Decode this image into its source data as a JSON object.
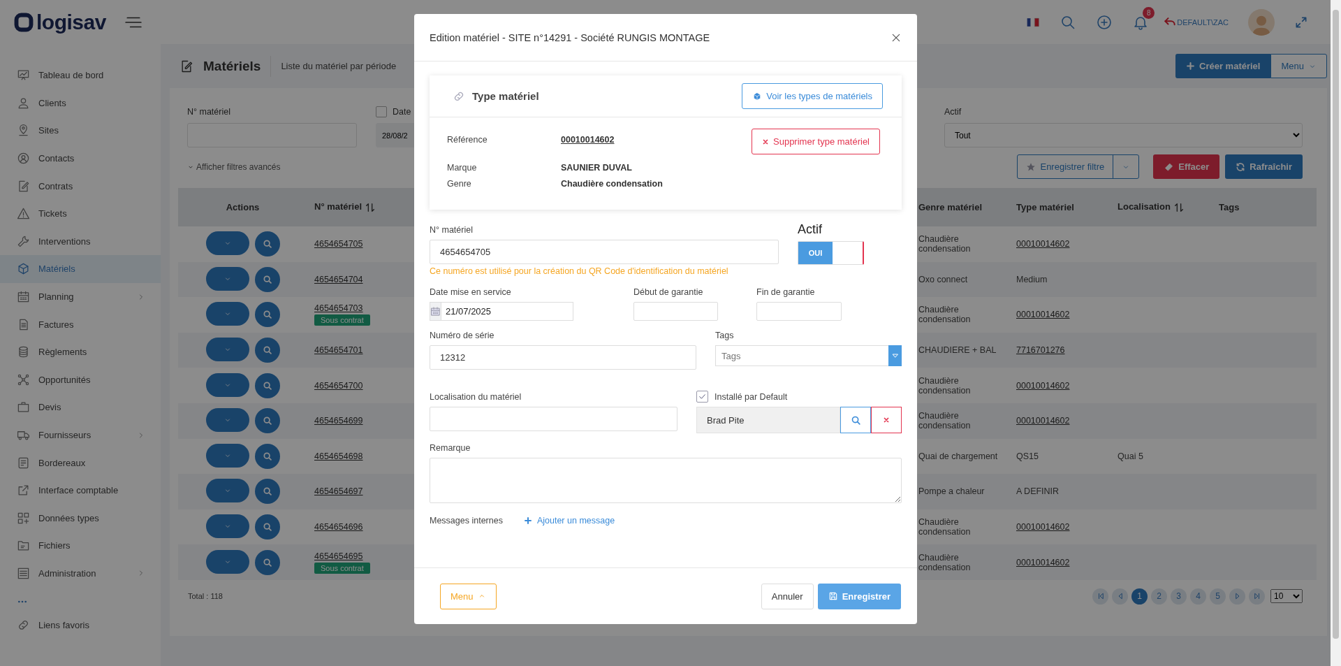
{
  "header": {
    "logo": "logisav",
    "notifications": "8",
    "user": "DEFAULT\\ZAC"
  },
  "sidebar": {
    "items": [
      {
        "label": "Tableau de bord",
        "selected": false,
        "submenu": false
      },
      {
        "label": "Clients",
        "selected": false,
        "submenu": false
      },
      {
        "label": "Sites",
        "selected": false,
        "submenu": false
      },
      {
        "label": "Contacts",
        "selected": false,
        "submenu": false
      },
      {
        "label": "Contrats",
        "selected": false,
        "submenu": false
      },
      {
        "label": "Tickets",
        "selected": false,
        "submenu": false
      },
      {
        "label": "Interventions",
        "selected": false,
        "submenu": false
      },
      {
        "label": "Matériels",
        "selected": true,
        "submenu": false
      },
      {
        "label": "Planning",
        "selected": false,
        "submenu": true
      },
      {
        "label": "Factures",
        "selected": false,
        "submenu": false
      },
      {
        "label": "Règlements",
        "selected": false,
        "submenu": false
      },
      {
        "label": "Opportunités",
        "selected": false,
        "submenu": false
      },
      {
        "label": "Devis",
        "selected": false,
        "submenu": false
      },
      {
        "label": "Fournisseurs",
        "selected": false,
        "submenu": true
      },
      {
        "label": "Bordereaux",
        "selected": false,
        "submenu": false
      },
      {
        "label": "Interface comptable",
        "selected": false,
        "submenu": false
      },
      {
        "label": "Données types",
        "selected": false,
        "submenu": false
      },
      {
        "label": "Fichiers",
        "selected": false,
        "submenu": false
      },
      {
        "label": "Administration",
        "selected": false,
        "submenu": true
      }
    ],
    "favorites": "Liens favoris"
  },
  "page": {
    "title": "Matériels",
    "subtitle": "Liste du matériel par période",
    "create_button": "Créer matériel",
    "menu_button": "Menu"
  },
  "filters": {
    "number_label": "N° matériel",
    "date_label": "Date",
    "date_checked": false,
    "date_value": "28/08/2",
    "advanced": "Afficher filtres avancés",
    "actif_label": "Actif",
    "actif_value": "Tout",
    "save_filter": "Enregistrer filtre",
    "clear": "Effacer",
    "refresh": "Rafraîchir"
  },
  "table": {
    "columns": [
      {
        "label": "Actions",
        "sortable": false
      },
      {
        "label": "N° matériel",
        "sortable": true
      },
      {
        "label": "Genre matériel",
        "sortable": false
      },
      {
        "label": "Type matériel",
        "sortable": false
      },
      {
        "label": "Localisation",
        "sortable": true
      },
      {
        "label": "Tags",
        "sortable": false
      }
    ],
    "rows": [
      {
        "number": "4654654705",
        "genre": "Chaudière condensation",
        "type": "00010014602",
        "type_is_link": true
      },
      {
        "number": "4654654704",
        "genre": "Oxo connect",
        "type": "Medium",
        "type_is_link": false
      },
      {
        "number": "4654654703",
        "badge": "Sous contrat",
        "genre": "Chaudière condensation",
        "type": "00010014602",
        "type_is_link": true
      },
      {
        "number": "4654654701",
        "genre": "CHAUDIERE + BAL",
        "type": "7716701276",
        "type_is_link": true
      },
      {
        "number": "4654654700",
        "genre": "Chaudière condensation",
        "type": "00010014602",
        "type_is_link": true
      },
      {
        "number": "4654654699",
        "genre": "Chaudière condensation",
        "type": "00010014602",
        "type_is_link": true
      },
      {
        "number": "4654654698",
        "genre": "Quai de chargement",
        "type": "QS15",
        "type_is_link": false,
        "location": "Quai 5"
      },
      {
        "number": "4654654697",
        "genre": "Pompe a chaleur",
        "type": "A DEFINIR",
        "type_is_link": false
      },
      {
        "number": "4654654696",
        "genre": "Chaudière condensation",
        "type": "00010014602",
        "type_is_link": true
      },
      {
        "number": "4654654695",
        "badge": "Sous contrat",
        "genre": "Chaudière condensation",
        "type": "00010014602",
        "type_is_link": true
      }
    ],
    "total": "Total : 118"
  },
  "pagination": {
    "pages": [
      {
        "label": "1",
        "selected": true
      },
      {
        "label": "2",
        "selected": false
      },
      {
        "label": "3",
        "selected": false
      },
      {
        "label": "4",
        "selected": false
      },
      {
        "label": "5",
        "selected": false
      }
    ],
    "page_size": "10"
  },
  "modal": {
    "title": "Edition matériel - SITE n°14291 - Société RUNGIS MONTAGE",
    "type_card": {
      "title": "Type matériel",
      "view_button": "Voir les types de matériels",
      "delete_button": "Supprimer type matériel",
      "fields": [
        {
          "label": "Référence",
          "value": "00010014602",
          "kind": "link"
        },
        {
          "label": "Marque",
          "value": "SAUNIER DUVAL",
          "kind": "text"
        },
        {
          "label": "Genre",
          "value": "Chaudière condensation",
          "kind": "text"
        }
      ]
    },
    "form": {
      "number": {
        "label": "N° matériel",
        "value": "4654654705",
        "hint": "Ce numéro est utilisé pour la création du QR Code d'identification du matériel"
      },
      "actif": {
        "label": "Actif",
        "on": true,
        "on_label": "OUI"
      },
      "service_date": {
        "label": "Date mise en service",
        "value": "21/07/2025"
      },
      "warranty_start": {
        "label": "Début de garantie"
      },
      "warranty_end": {
        "label": "Fin de garantie"
      },
      "serial": {
        "label": "Numéro de série",
        "value": "12312"
      },
      "tags": {
        "label": "Tags",
        "placeholder": "Tags"
      },
      "location": {
        "label": "Localisation du matériel"
      },
      "installer": {
        "label": "Installé par Default",
        "checked": true,
        "value": "Brad Pite"
      },
      "remark": {
        "label": "Remarque"
      },
      "messages": {
        "label": "Messages internes",
        "add": "Ajouter un message"
      }
    },
    "footer": {
      "menu": "Menu",
      "cancel": "Annuler",
      "save": "Enregistrer"
    }
  }
}
